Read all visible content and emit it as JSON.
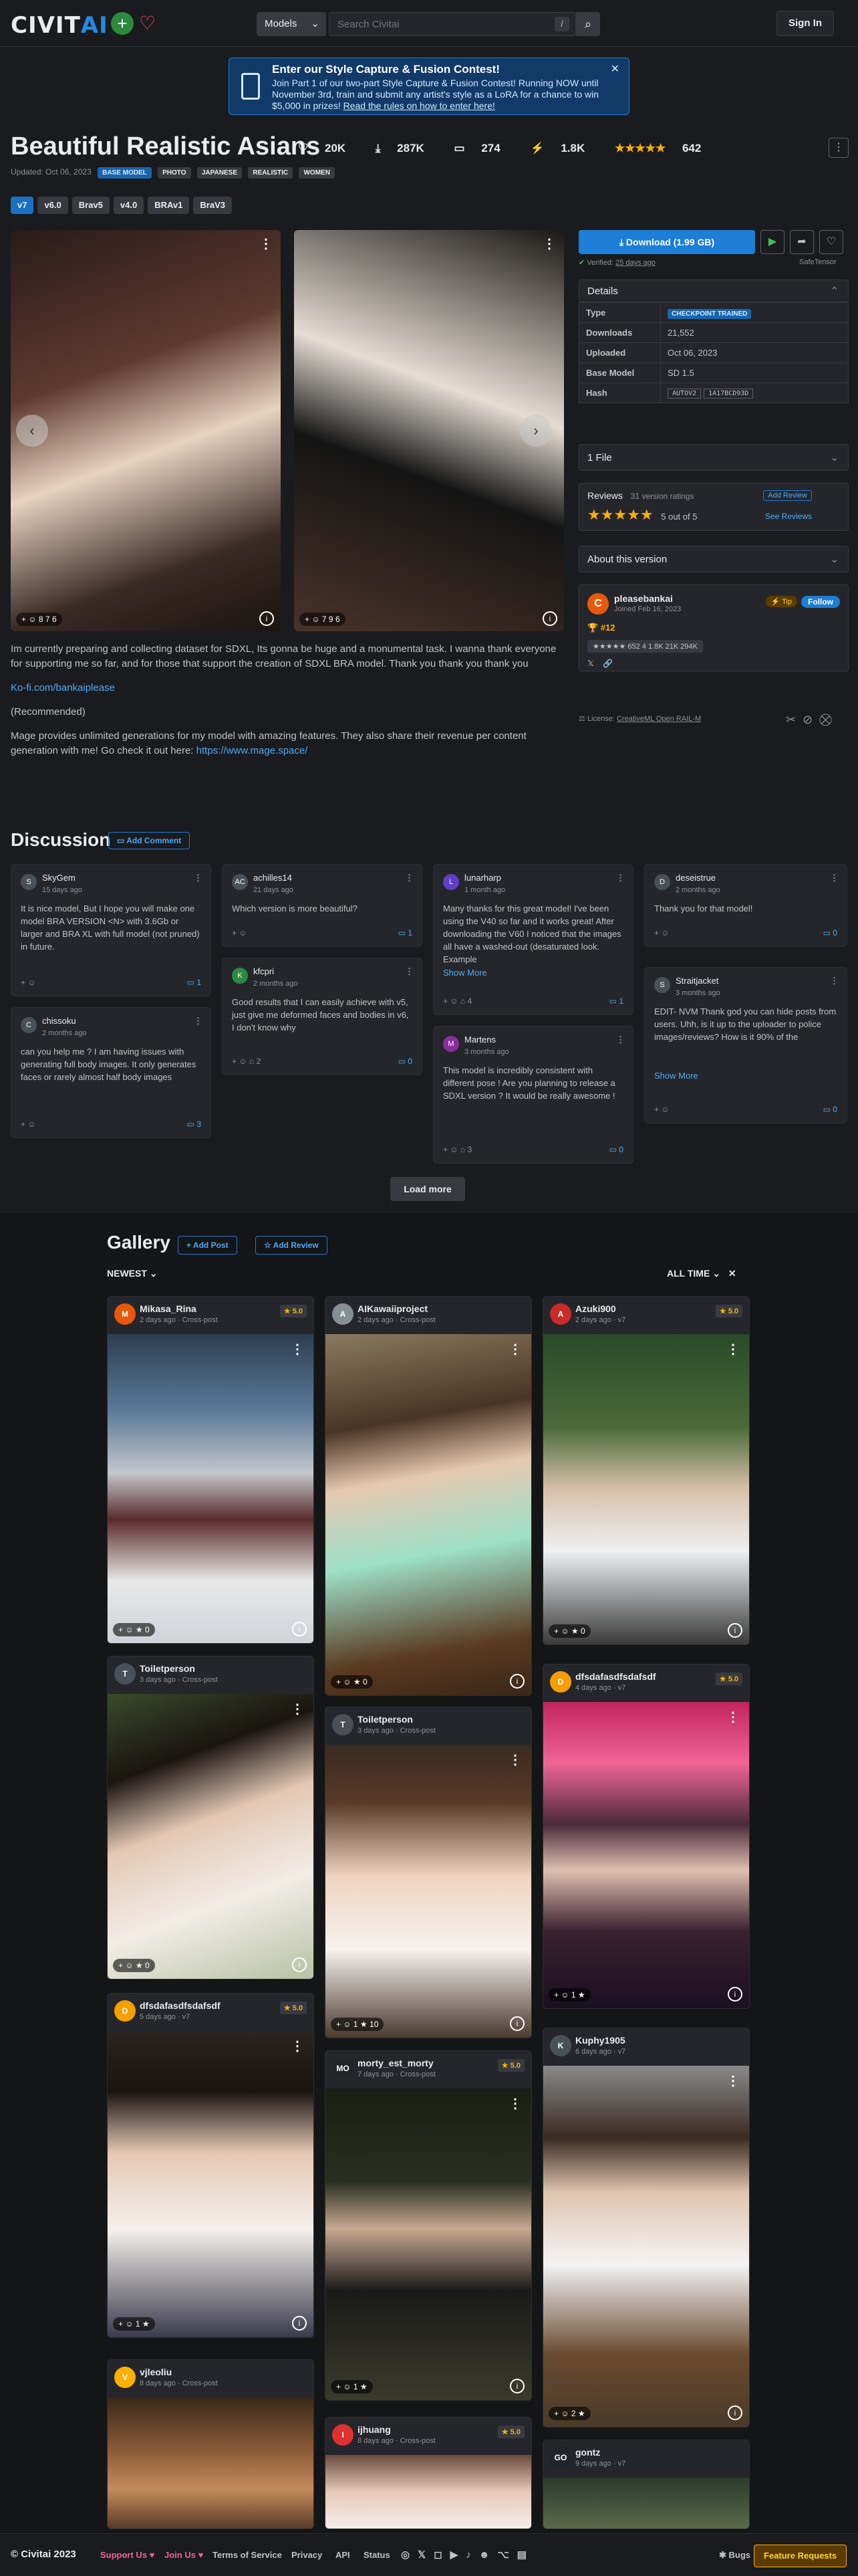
{
  "header": {
    "logo_main": "CIVIT",
    "logo_accent": "AI",
    "models_select": "Models",
    "search_placeholder": "Search Civitai",
    "slash_key": "/",
    "sign_in": "Sign In"
  },
  "banner": {
    "title": "Enter our Style Capture & Fusion Contest!",
    "body": "Join Part 1 of our two-part Style Capture & Fusion Contest! Running NOW until November 3rd, train and submit any artist's style as a LoRA for a chance to win $5,000 in prizes!",
    "link": "Read the rules on how to enter here!"
  },
  "model": {
    "title": "Beautiful Realistic Asians",
    "likes": "20K",
    "downloads": "287K",
    "comments": "274",
    "buzz": "1.8K",
    "stars": "★★★★★",
    "rating_count": "642",
    "updated": "Updated: Oct 06, 2023",
    "badges": [
      "BASE MODEL",
      "PHOTO",
      "JAPANESE",
      "REALISTIC",
      "WOMEN"
    ],
    "versions": [
      "v7",
      "v6.0",
      "Brav5",
      "v4.0",
      "BRAv1",
      "BraV3"
    ]
  },
  "images": [
    {
      "stats": "+ ☺  8  7  6"
    },
    {
      "stats": "+ ☺  7  9  6"
    }
  ],
  "sidebar": {
    "download_label": "Download (1.99 GB)",
    "verified": "Verified:",
    "verified_date": "25 days ago",
    "safetensor": "SafeTensor",
    "details_title": "Details",
    "details": [
      {
        "k": "Type",
        "v": "CHECKPOINT TRAINED"
      },
      {
        "k": "Downloads",
        "v": "21,552"
      },
      {
        "k": "Uploaded",
        "v": "Oct 06, 2023"
      },
      {
        "k": "Base Model",
        "v": "SD 1.5"
      }
    ],
    "hash_label": "Hash",
    "hash_algo": "AUTOV2",
    "hash_value": "1A17BCD93D",
    "files": "1 File",
    "reviews_title": "Reviews",
    "reviews_count": "31 version ratings",
    "add_review": "Add Review",
    "review_stars": "★★★★★",
    "review_score": "5 out of 5",
    "see_reviews": "See Reviews",
    "about": "About this version",
    "creator": "pleasebankai",
    "creator_joined": "Joined Feb 16, 2023",
    "tip": "Tip",
    "follow": "Follow",
    "rank": "#12",
    "creator_stats": "★★★★★ 652   4   1.8K   21K   294K",
    "license_prefix": "License:",
    "license": "CreativeML Open RAIL-M"
  },
  "description": {
    "p1": "Im currently preparing and collecting dataset for SDXL, Its gonna be huge and a monumental task. I wanna thank everyone for supporting me so far, and for those that support the creation of SDXL BRA model. Thank you thank you thank you",
    "kofi": "Ko-fi.com/bankaiplease",
    "rec": "(Recommended)",
    "p2": "Mage provides unlimited generations for my model with amazing features. They also share their revenue per content generation with me! Go check it out here: ",
    "mage": "https://www.mage.space/"
  },
  "discussion": {
    "title": "Discussion",
    "add_comment": "Add Comment",
    "load_more": "Load more",
    "comments": [
      {
        "user": "SkyGem",
        "time": "15 days ago",
        "text": "It is nice model, But I hope you will make one model BRA VERSION <N> with 3.6Gb or larger and BRA XL with full model (not pruned) in future.",
        "replies": "1"
      },
      {
        "user": "chissoku",
        "time": "2 months ago",
        "text": "can you help me ? I am having issues with generating full body images. It only generates faces or rarely almost half body images",
        "replies": "3"
      },
      {
        "user": "achilles14",
        "time": "21 days ago",
        "text": "Which version is more beautiful?",
        "replies": "1"
      },
      {
        "user": "kfcpri",
        "time": "2 months ago",
        "text": "Good results that I can easily achieve with v5, just give me deformed faces and bodies in v6, I don't know why",
        "replies": "0"
      },
      {
        "user": "lunarharp",
        "time": "1 month ago",
        "text": "Many thanks for this great model! I've been using the V40 so far and it works great! After downloading the V60 I noticed that the images all have a washed-out (desaturated look. Example",
        "more": "Show More",
        "replies": "1"
      },
      {
        "user": "Martens",
        "time": "3 months ago",
        "text": "This model is incredibly consistent with different pose ! Are you planning to release a SDXL version ? It would be really awesome !",
        "replies": "0"
      },
      {
        "user": "deseistrue",
        "time": "2 months ago",
        "text": "Thank you for that model!",
        "replies": "0"
      },
      {
        "user": "Straitjacket",
        "time": "3 months ago",
        "text": "EDIT- NVM Thank god you can hide posts from users. Uhh, is it up to the uploader to police images/reviews? How is it 90% of the",
        "more": "Show More",
        "replies": "0"
      }
    ]
  },
  "gallery": {
    "title": "Gallery",
    "add_post": "Add Post",
    "add_review": "Add Review",
    "sort": "NEWEST",
    "period": "ALL TIME",
    "cards": [
      {
        "user": "Mikasa_Rina",
        "sub": "2 days ago · Cross-post",
        "score": "5.0"
      },
      {
        "user": "Toiletperson",
        "sub": "3 days ago · Cross-post",
        "score": ""
      },
      {
        "user": "dfsdafasdfsdafsdf",
        "sub": "5 days ago · v7",
        "score": "5.0"
      },
      {
        "user": "vjleoliu",
        "sub": "8 days ago · Cross-post",
        "score": ""
      },
      {
        "user": "AIKawaiiproject",
        "sub": "2 days ago · Cross-post",
        "score": ""
      },
      {
        "user": "Toiletperson",
        "sub": "3 days ago · Cross-post",
        "score": ""
      },
      {
        "user": "morty_est_morty",
        "sub": "7 days ago · Cross-post",
        "score": "5.0"
      },
      {
        "user": "ijhuang",
        "sub": "8 days ago · Cross-post",
        "score": "5.0"
      },
      {
        "user": "Azuki900",
        "sub": "2 days ago · v7",
        "score": "5.0"
      },
      {
        "user": "dfsdafasdfsdafsdf",
        "sub": "4 days ago · v7",
        "score": "5.0"
      },
      {
        "user": "Kuphy1905",
        "sub": "6 days ago · v7",
        "score": ""
      },
      {
        "user": "gontz",
        "sub": "9 days ago · v7",
        "score": ""
      }
    ]
  },
  "footer": {
    "copyright": "© Civitai 2023",
    "support": "Support Us",
    "join": "Join Us",
    "terms": "Terms of Service",
    "privacy": "Privacy",
    "api": "API",
    "status": "Status",
    "bugs": "Bugs",
    "requests": "Feature Requests"
  }
}
